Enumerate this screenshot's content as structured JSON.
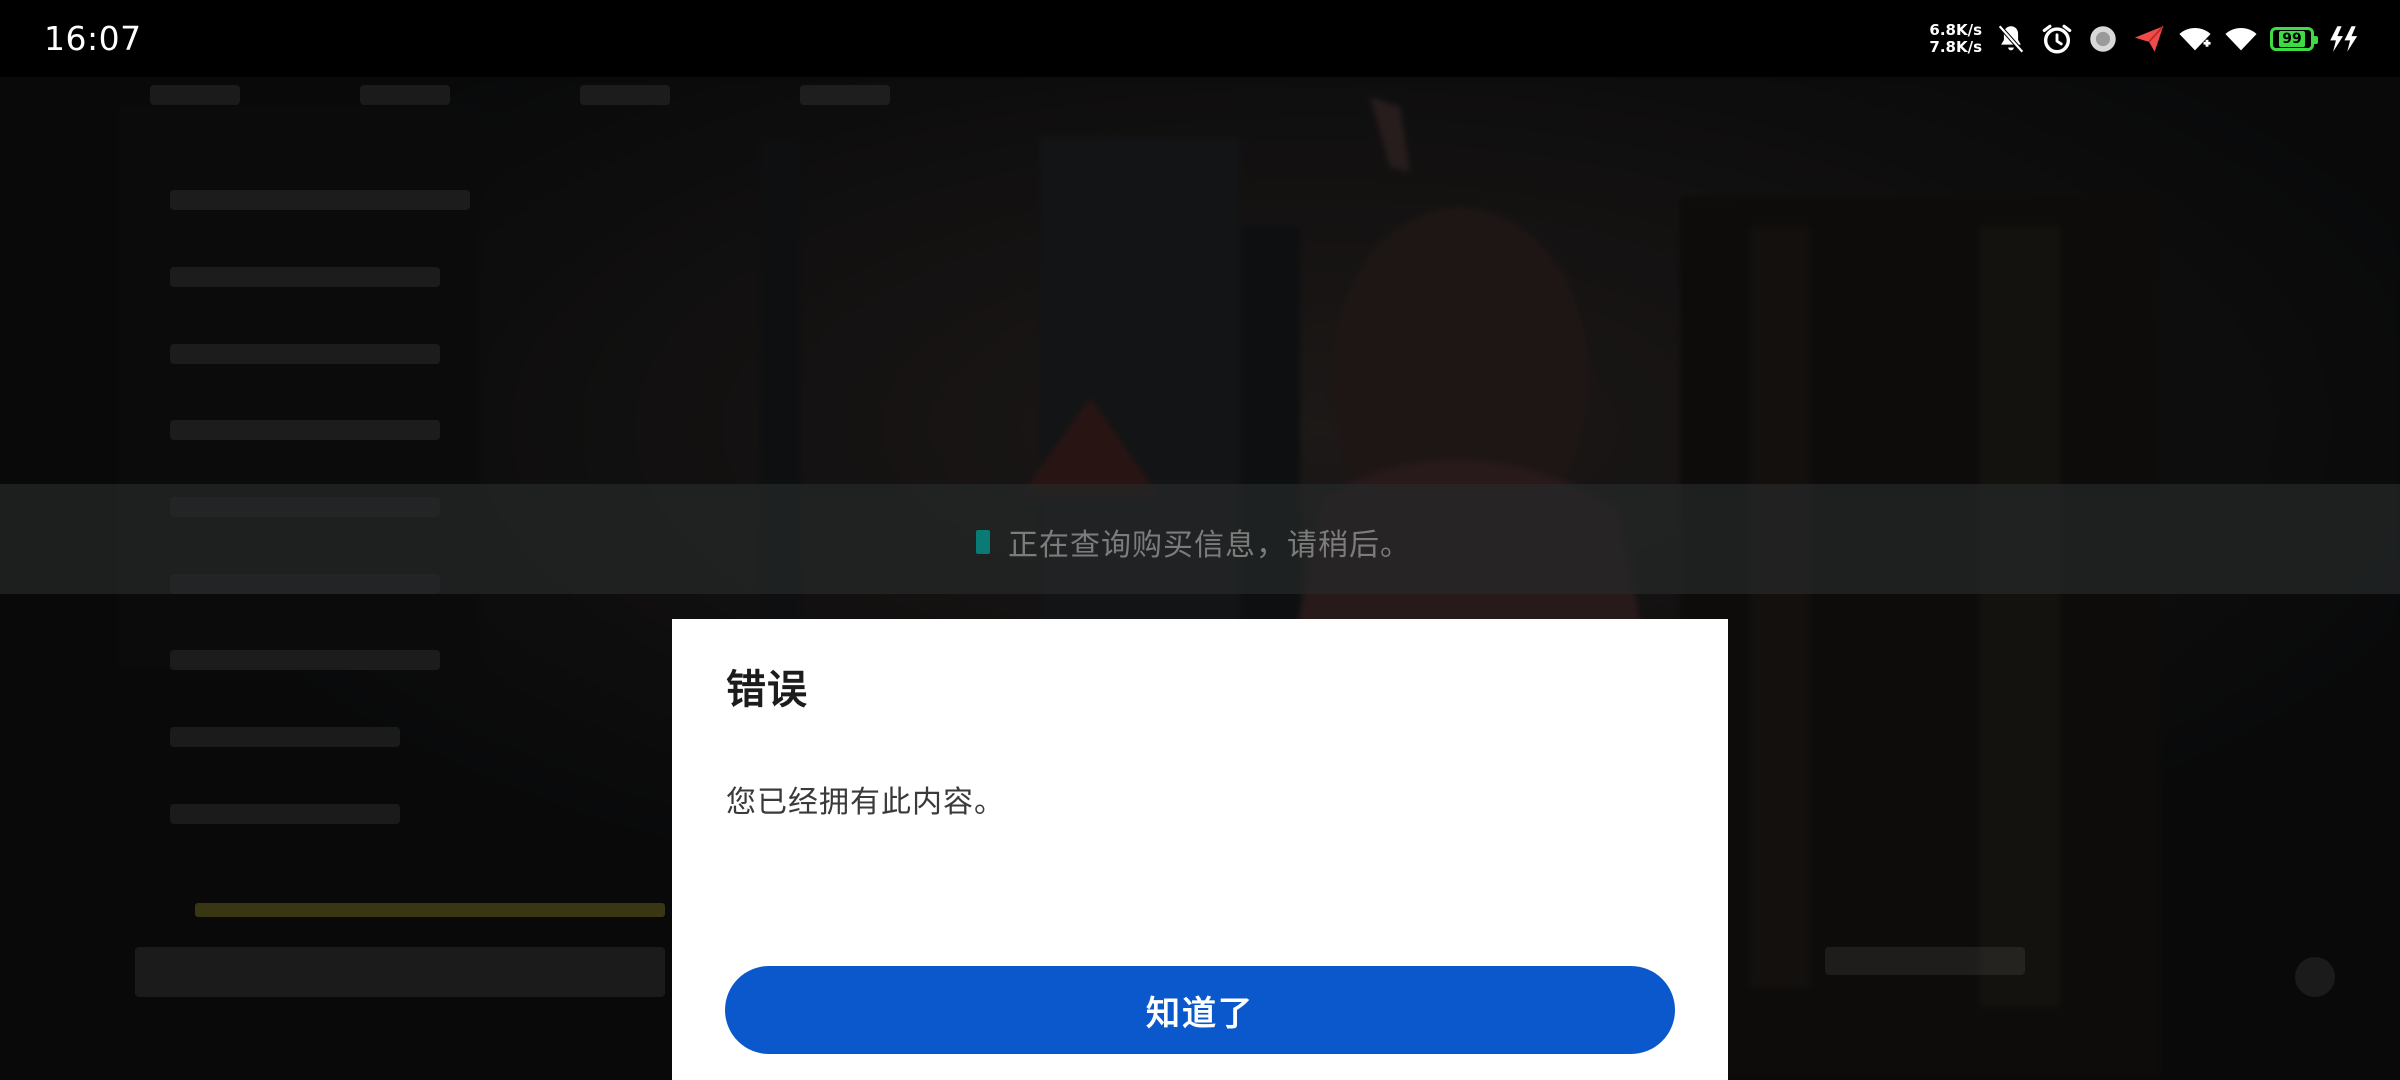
{
  "status_bar": {
    "time": "16:07",
    "net_speed_up": "6.8K/s",
    "net_speed_down": "7.8K/s",
    "battery_level": "99",
    "icons": [
      "mute-bell-icon",
      "alarm-icon",
      "record-dot-icon",
      "send-icon",
      "wifi-icon",
      "wifi-icon",
      "battery-icon",
      "fast-charge-icon"
    ],
    "battery_color": "#3ddc44"
  },
  "loading": {
    "text": "正在查询购买信息，请稍后。",
    "icon": "loading-square-icon",
    "icon_color": "#0a7a74"
  },
  "dialog": {
    "title": "错误",
    "message": "您已经拥有此内容。",
    "button_label": "知道了",
    "button_color": "#0b58cc"
  }
}
